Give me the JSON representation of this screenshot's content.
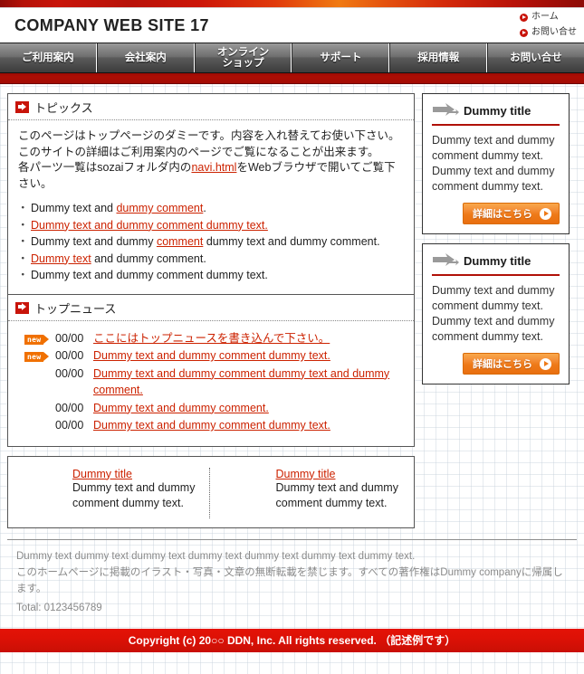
{
  "header": {
    "title": "COMPANY WEB SITE 17",
    "links": [
      {
        "label": "ホーム"
      },
      {
        "label": "お問い合せ"
      }
    ]
  },
  "nav": {
    "items": [
      {
        "line1": "ご利用案内",
        "line2": ""
      },
      {
        "line1": "会社案内",
        "line2": ""
      },
      {
        "line1": "オンライン",
        "line2": "ショップ"
      },
      {
        "line1": "サポート",
        "line2": ""
      },
      {
        "line1": "採用情報",
        "line2": ""
      },
      {
        "line1": "お問い合せ",
        "line2": ""
      }
    ]
  },
  "topics": {
    "heading": "トピックス",
    "paragraph_1": "このページはトップページのダミーです。内容を入れ替えてお使い下さい。このサイトの詳細はご利用案内のページでご覧になることが出来ます。",
    "paragraph_2_before": "各パーツ一覧はsozaiフォルダ内の",
    "paragraph_2_link": "navi.html",
    "paragraph_2_after": "をWebブラウザで開いてご覧下さい。",
    "list": [
      {
        "pre": "Dummy text and ",
        "link": "dummy comment",
        "post": "."
      },
      {
        "pre": "",
        "link": "Dummy text and dummy comment dummy text.",
        "post": ""
      },
      {
        "pre": "Dummy text and dummy ",
        "link": "comment",
        "post": " dummy text and dummy comment."
      },
      {
        "pre": "",
        "link": "Dummy text",
        "post": " and dummy comment."
      },
      {
        "pre": "Dummy text and dummy comment dummy text.",
        "link": "",
        "post": ""
      }
    ]
  },
  "news": {
    "heading": "トップニュース",
    "new_badge_label": "new",
    "items": [
      {
        "new": true,
        "date": "00/00",
        "text": "ここにはトップニュースを書き込んで下さい。"
      },
      {
        "new": true,
        "date": "00/00",
        "text": "Dummy text and dummy comment dummy text."
      },
      {
        "new": false,
        "date": "00/00",
        "text": "Dummy text and dummy comment dummy text and dummy comment."
      },
      {
        "new": false,
        "date": "00/00",
        "text": "Dummy text and dummy comment."
      },
      {
        "new": false,
        "date": "00/00",
        "text": "Dummy text and dummy comment dummy text."
      }
    ]
  },
  "thumbs": [
    {
      "title": "Dummy title",
      "text": "Dummy text and dummy comment dummy text."
    },
    {
      "title": "Dummy title",
      "text": "Dummy text and dummy comment dummy text."
    }
  ],
  "side_boxes": [
    {
      "title": "Dummy title",
      "text": "Dummy text and dummy comment dummy text. Dummy text and dummy comment dummy text.",
      "button_label": "詳細はこちら"
    },
    {
      "title": "Dummy title",
      "text": "Dummy text and dummy comment dummy text. Dummy text and dummy comment dummy text.",
      "button_label": "詳細はこちら"
    }
  ],
  "footer": {
    "line1": "Dummy text dummy text dummy text dummy text dummy text dummy text dummy text.",
    "line2": "このホームページに掲載のイラスト・写真・文章の無断転載を禁じます。すべての著作権はDummy companyに帰属します。",
    "total": "Total:  0123456789",
    "copyright": "Copyright (c) 20○○ DDN, Inc. All rights reserved. （記述例です）"
  },
  "colors": {
    "brand_red": "#c8140a",
    "deep_red": "#a40c04",
    "accent_orange": "#ee7a18",
    "link_red": "#cc2200",
    "nav_dark": "#3d3d3d"
  }
}
